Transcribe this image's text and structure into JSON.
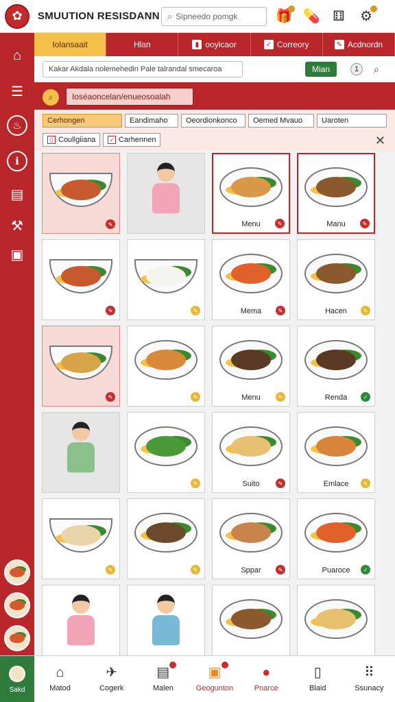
{
  "header": {
    "title": "SMUUTION RESISDANN",
    "search_placeholder": "Sipneedo pomgk",
    "icons": [
      "gift-icon",
      "pill-icon",
      "dice-icon",
      "gear-icon"
    ]
  },
  "tabs": [
    {
      "label": "Iolansaait",
      "icon": "",
      "active": true
    },
    {
      "label": "Hlan",
      "icon": "",
      "active": false
    },
    {
      "label": "ooyicaor",
      "icon": "clipboard-icon",
      "active": false
    },
    {
      "label": "Correory",
      "icon": "checklist-icon",
      "active": false
    },
    {
      "label": "Acdnordn",
      "icon": "edit-icon",
      "active": false
    }
  ],
  "address": {
    "value": "Kakar Akdala nolemehedin Pale talrandal smecaroa",
    "main_button": "Mian",
    "badge_count": "1"
  },
  "filters": {
    "query": "Ioséaoncelan/enueosoalah",
    "chips_row1": [
      "Cerhongen",
      "Eandimaho",
      "Oeordionkonco",
      "Oemed Mvauo",
      "Uaroten"
    ],
    "chips_row2": [
      "Coullgiiana",
      "Carhennen"
    ]
  },
  "grid": [
    {
      "label": "",
      "status": "red",
      "kind": "bowl",
      "bg": "pink",
      "food": "#c65a2e"
    },
    {
      "label": "",
      "status": "",
      "kind": "person",
      "bg": "gray",
      "food": "#f2a4b8"
    },
    {
      "label": "Menu",
      "status": "red",
      "kind": "plate",
      "bg": "sel",
      "food": "#d89a4a"
    },
    {
      "label": "Manu",
      "status": "red",
      "kind": "plate",
      "bg": "sel",
      "food": "#8a5a2e"
    },
    {
      "label": "",
      "status": "red",
      "kind": "bowl",
      "bg": "white",
      "food": "#c65a2e"
    },
    {
      "label": "",
      "status": "yellow",
      "kind": "bowl",
      "bg": "white",
      "food": "#f5f5f0"
    },
    {
      "label": "Mema",
      "status": "red",
      "kind": "plate",
      "bg": "white",
      "food": "#e0622a"
    },
    {
      "label": "Hacen",
      "status": "yellow",
      "kind": "plate",
      "bg": "white",
      "food": "#8a5a2e"
    },
    {
      "label": "",
      "status": "red",
      "kind": "bowl",
      "bg": "pink",
      "food": "#d8a44a"
    },
    {
      "label": "",
      "status": "yellow",
      "kind": "plate",
      "bg": "white",
      "food": "#d88a3a"
    },
    {
      "label": "Menu",
      "status": "yellow",
      "kind": "plate",
      "bg": "white",
      "food": "#5a3a24"
    },
    {
      "label": "Renda",
      "status": "green",
      "kind": "plate",
      "bg": "white",
      "food": "#5a3a24"
    },
    {
      "label": "",
      "status": "",
      "kind": "person",
      "bg": "gray",
      "food": "#8ac08a"
    },
    {
      "label": "",
      "status": "yellow",
      "kind": "plate",
      "bg": "white",
      "food": "#4a9a3a"
    },
    {
      "label": "Suito",
      "status": "red",
      "kind": "plate",
      "bg": "white",
      "food": "#e8c070"
    },
    {
      "label": "Emlace",
      "status": "yellow",
      "kind": "plate",
      "bg": "white",
      "food": "#d8843a"
    },
    {
      "label": "",
      "status": "yellow",
      "kind": "bowl",
      "bg": "white",
      "food": "#e8d4a8"
    },
    {
      "label": "",
      "status": "yellow",
      "kind": "plate",
      "bg": "white",
      "food": "#6a4a2a"
    },
    {
      "label": "Sppar",
      "status": "red",
      "kind": "plate",
      "bg": "white",
      "food": "#c8844a"
    },
    {
      "label": "Puaroce",
      "status": "green",
      "kind": "plate",
      "bg": "white",
      "food": "#e0622a"
    },
    {
      "label": "",
      "status": "",
      "kind": "person",
      "bg": "white",
      "food": "#f2a4b8"
    },
    {
      "label": "",
      "status": "",
      "kind": "person",
      "bg": "white",
      "food": "#7ab8d8"
    },
    {
      "label": "",
      "status": "",
      "kind": "plate",
      "bg": "white",
      "food": "#8a5a2e"
    },
    {
      "label": "",
      "status": "",
      "kind": "plate",
      "bg": "white",
      "food": "#e8c070"
    }
  ],
  "bottom_nav": [
    {
      "label": "Sakd",
      "icon": "salad-icon",
      "style": "first"
    },
    {
      "label": "Matod",
      "icon": "home-icon",
      "style": ""
    },
    {
      "label": "Cogerk",
      "icon": "plane-icon",
      "style": ""
    },
    {
      "label": "Malen",
      "icon": "menu-book-icon",
      "style": ""
    },
    {
      "label": "Geogunton",
      "icon": "box-icon",
      "style": "active"
    },
    {
      "label": "Pnarce",
      "icon": "pin-icon",
      "style": "red"
    },
    {
      "label": "Blaid",
      "icon": "door-icon",
      "style": ""
    },
    {
      "label": "Ssunacy",
      "icon": "dots-icon",
      "style": ""
    }
  ],
  "colors": {
    "primary": "#b8262a",
    "accent": "#f4c04a",
    "green": "#2f7b3a"
  }
}
